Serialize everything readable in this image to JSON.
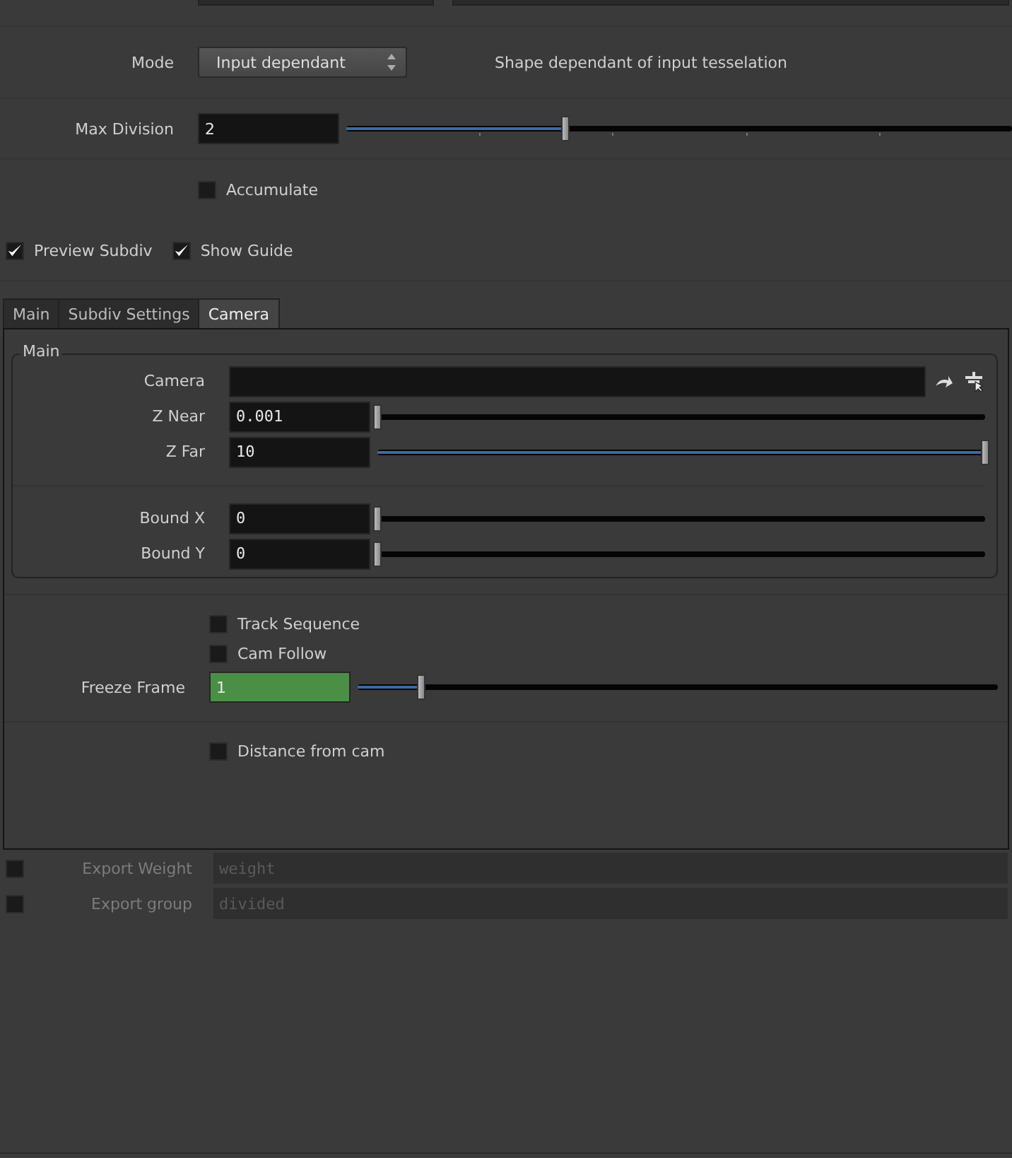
{
  "mode": {
    "label": "Mode",
    "value": "Input dependant",
    "description": "Shape dependant of input tesselation"
  },
  "max_division": {
    "label": "Max Division",
    "value": "2",
    "level": 0.33
  },
  "accumulate": {
    "label": "Accumulate",
    "checked": false
  },
  "toggles": [
    {
      "label": "Preview Subdiv",
      "checked": true
    },
    {
      "label": "Show Guide",
      "checked": true
    }
  ],
  "tabs": [
    {
      "label": "Main",
      "selected": false
    },
    {
      "label": "Subdiv Settings",
      "selected": false
    },
    {
      "label": "Camera",
      "selected": true
    }
  ],
  "group": {
    "title": "Main",
    "camera_label": "Camera",
    "slider_groups": [
      [
        {
          "label": "Z Near",
          "value": "0.001",
          "level": 0
        },
        {
          "label": "Z Far",
          "value": "10",
          "level": 1
        }
      ],
      [
        {
          "label": "Bound X",
          "value": "0",
          "level": 0
        },
        {
          "label": "Bound Y",
          "value": "0",
          "level": 0
        }
      ]
    ]
  },
  "checkboxes": [
    {
      "label": "Track Sequence",
      "checked": false
    },
    {
      "label": "Cam Follow",
      "checked": false
    }
  ],
  "freeze_frame": {
    "label": "Freeze Frame",
    "value": "1",
    "keyed": true,
    "level": 0.1
  },
  "distance_from_cam": {
    "label": "Distance from cam",
    "checked": false
  },
  "exports": [
    {
      "label": "Export Weight",
      "checked": false,
      "disabled": true,
      "value": "weight"
    },
    {
      "label": "Export group",
      "checked": false,
      "disabled": true,
      "value": "divided"
    }
  ]
}
